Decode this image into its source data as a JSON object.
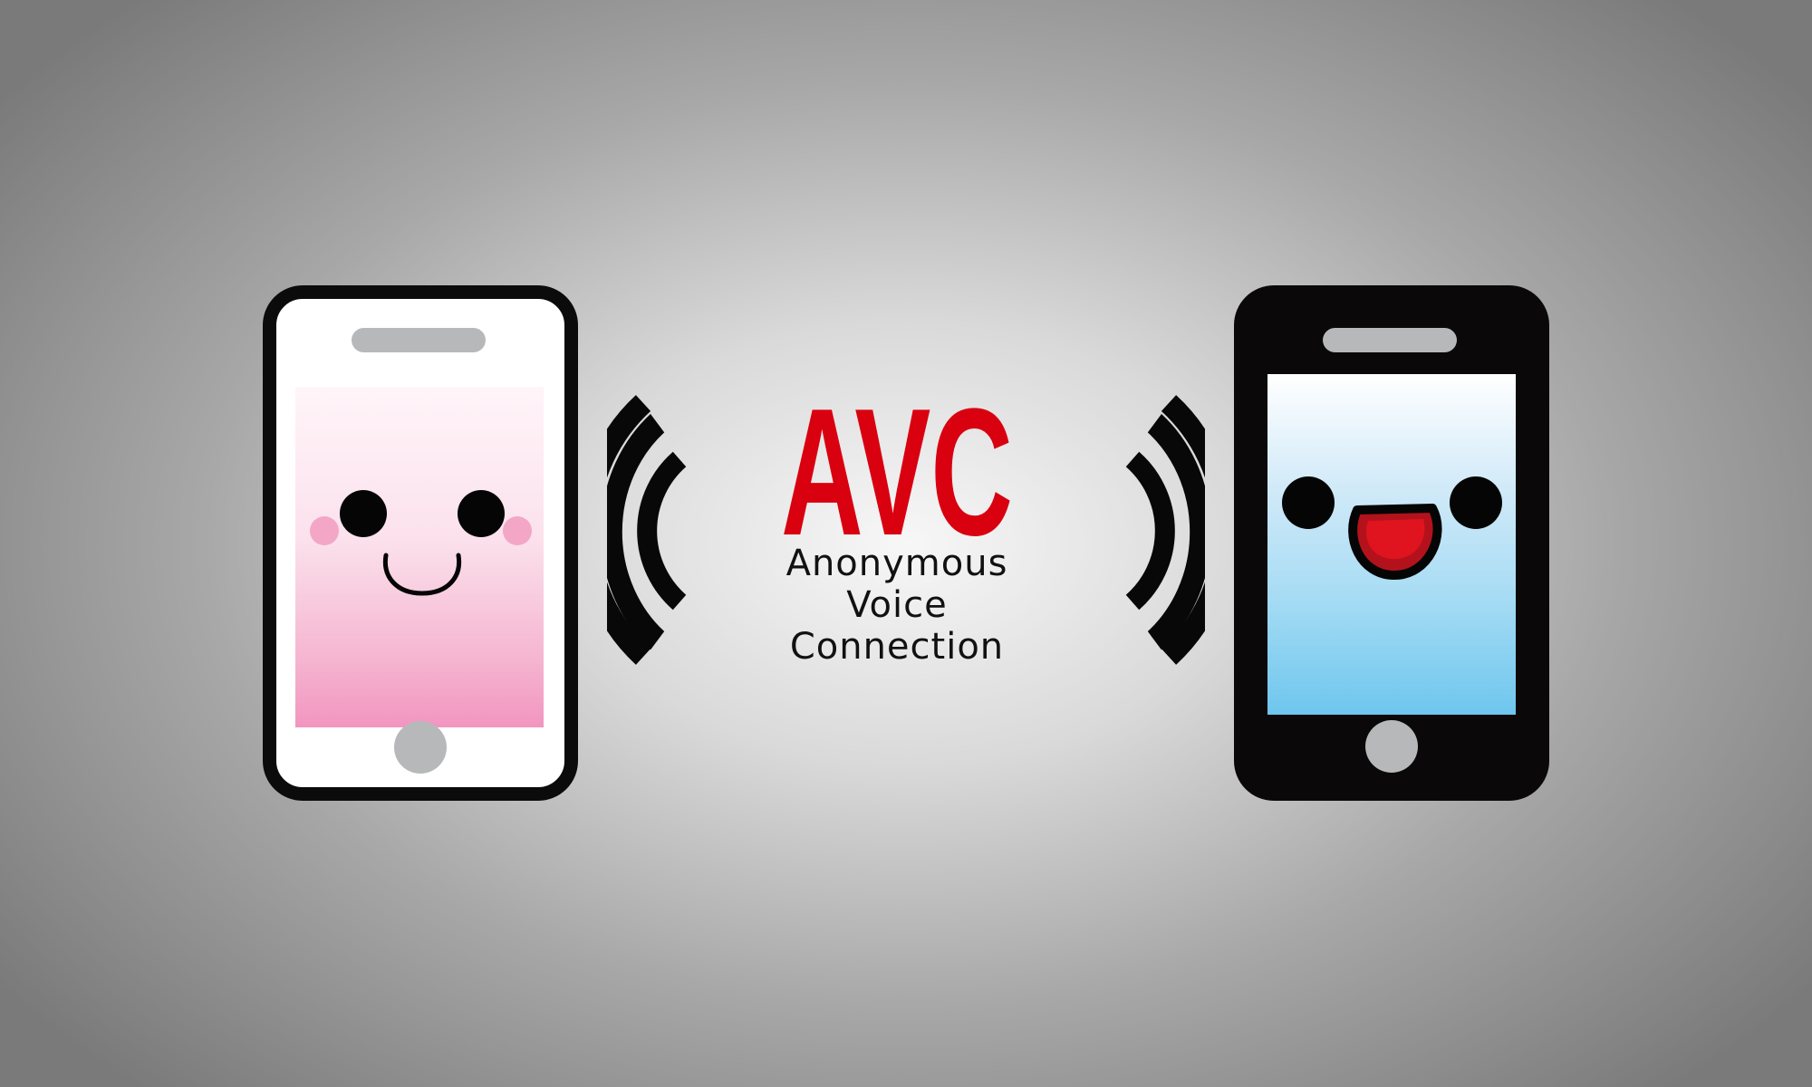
{
  "logo": {
    "acronym": "AVC",
    "line1": "Anonymous",
    "line2": "Voice",
    "line3": "Connection"
  },
  "colors": {
    "accent_red": "#d9000f",
    "phone_left_body": "#ffffff",
    "phone_right_body": "#0a0808",
    "screen_left_tint": "#f295c0",
    "screen_right_tint": "#6ec6ee",
    "outline": "#0b0b0b"
  },
  "icons": {
    "left_phone": "smartphone-icon",
    "right_phone": "smartphone-icon",
    "left_face": "smiling-face-icon",
    "right_face": "laughing-face-icon",
    "left_signal": "sound-waves-icon",
    "right_signal": "sound-waves-icon"
  }
}
